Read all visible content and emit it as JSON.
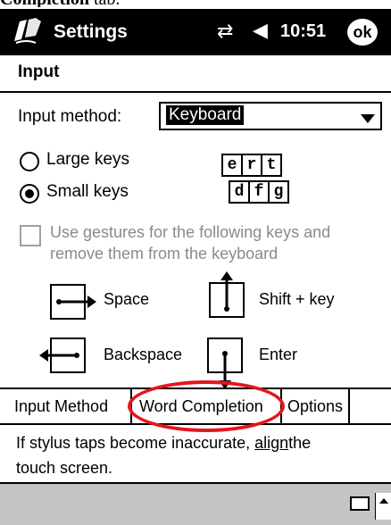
{
  "caption": {
    "bold": "Completion",
    "rest": " tab."
  },
  "titlebar": {
    "title": "Settings",
    "connection_glyph": "⇄",
    "volume_glyph": "◀",
    "time": "10:51",
    "ok_label": "ok"
  },
  "header": {
    "title": "Input"
  },
  "input_method": {
    "label": "Input method:",
    "value": "Keyboard"
  },
  "options": {
    "large_keys": "Large keys",
    "small_keys": "Small keys",
    "selected": "small_keys"
  },
  "key_preview": {
    "row1": [
      "e",
      "r",
      "t"
    ],
    "row2": [
      "d",
      "f",
      "g"
    ]
  },
  "gestures": {
    "checkbox_label_line1": "Use gestures for the following keys and",
    "checkbox_label_line2": "remove them from the keyboard",
    "space": "Space",
    "shift": "Shift + key",
    "backspace": "Backspace",
    "enter": "Enter"
  },
  "tabs": {
    "input_method": "Input Method",
    "word_completion": "Word Completion",
    "options": "Options"
  },
  "info": {
    "line1_before": "If stylus taps become inaccurate, ",
    "link": "align",
    "line1_after": "the",
    "line2": "touch screen."
  },
  "highlight_color": "#e4161e"
}
